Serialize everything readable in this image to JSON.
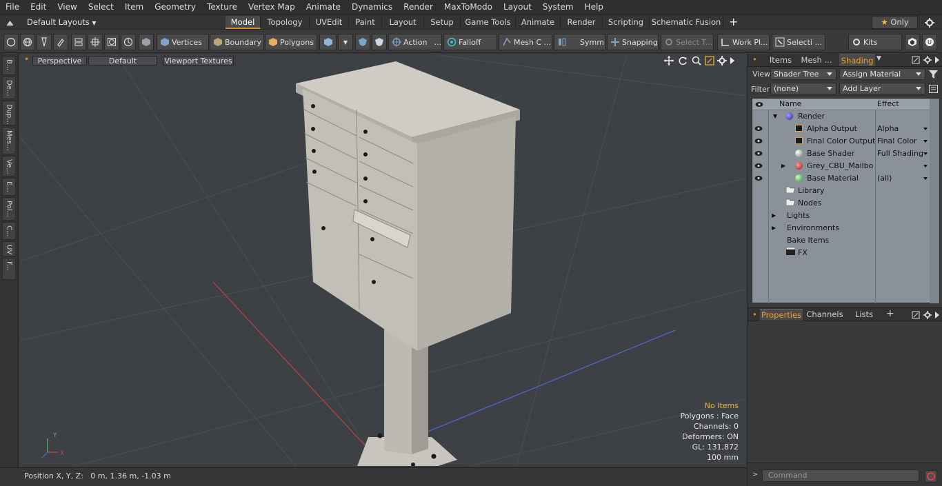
{
  "menu": [
    "File",
    "Edit",
    "View",
    "Select",
    "Item",
    "Geometry",
    "Texture",
    "Vertex Map",
    "Animate",
    "Dynamics",
    "Render",
    "MaxToModo",
    "Layout",
    "System",
    "Help"
  ],
  "layout_dropdown": "Default Layouts",
  "tabs": [
    "Model",
    "Topology",
    "UVEdit",
    "Paint",
    "Layout",
    "Setup",
    "Game Tools",
    "Animate",
    "Render",
    "Scripting",
    "Schematic Fusion"
  ],
  "only_label": "Only",
  "toolbar": {
    "vertices": "Vertices",
    "boundary": "Boundary",
    "polygons": "Polygons",
    "action": "Action",
    "falloff": "Falloff",
    "mesh": "Mesh C ...",
    "symm": "Symm ...",
    "snapping": "Snapping",
    "select_t": "Select T...",
    "work_pl": "Work Pl...",
    "selecti": "Selecti ...",
    "kits": "Kits"
  },
  "left_tabs": [
    "B...",
    "De...",
    "Dup...",
    "Mes...",
    "Ve...",
    "E...",
    "Pol...",
    "C...",
    "UV",
    "F..."
  ],
  "viewport": {
    "perspective": "Perspective",
    "default": "Default",
    "textures": "Viewport Textures",
    "stats": {
      "no_items": "No Items",
      "polygons": "Polygons : Face",
      "channels": "Channels: 0",
      "deformers": "Deformers: ON",
      "gl": "GL: 131,872",
      "scale": "100 mm"
    },
    "axis_y": "Y",
    "axis_x": "X"
  },
  "status": "Position X, Y, Z:   0 m, 1.36 m, -1.03 m",
  "right": {
    "tabs": [
      "Items",
      "Mesh ...",
      "Shading"
    ],
    "view_label": "View",
    "view_value": "Shader Tree",
    "assign": "Assign Material",
    "filter_label": "Filter",
    "filter_value": "(none)",
    "add_layer": "Add Layer",
    "col_name": "Name",
    "col_effect": "Effect",
    "rows": [
      {
        "name": "Render",
        "effect": ""
      },
      {
        "name": "Alpha Output",
        "effect": "Alpha"
      },
      {
        "name": "Final Color Output",
        "effect": "Final Color"
      },
      {
        "name": "Base Shader",
        "effect": "Full Shading"
      },
      {
        "name": "Grey_CBU_Mailbo ...",
        "effect": ""
      },
      {
        "name": "Base Material",
        "effect": "(all)"
      },
      {
        "name": "Library",
        "effect": ""
      },
      {
        "name": "Nodes",
        "effect": ""
      },
      {
        "name": "Lights",
        "effect": ""
      },
      {
        "name": "Environments",
        "effect": ""
      },
      {
        "name": "Bake Items",
        "effect": ""
      },
      {
        "name": "FX",
        "effect": ""
      }
    ],
    "props_tabs": [
      "Properties",
      "Channels",
      "Lists"
    ],
    "command_placeholder": "Command"
  },
  "colors": {
    "accent": "#d98b2a",
    "tree_bg": "#8b9199"
  }
}
